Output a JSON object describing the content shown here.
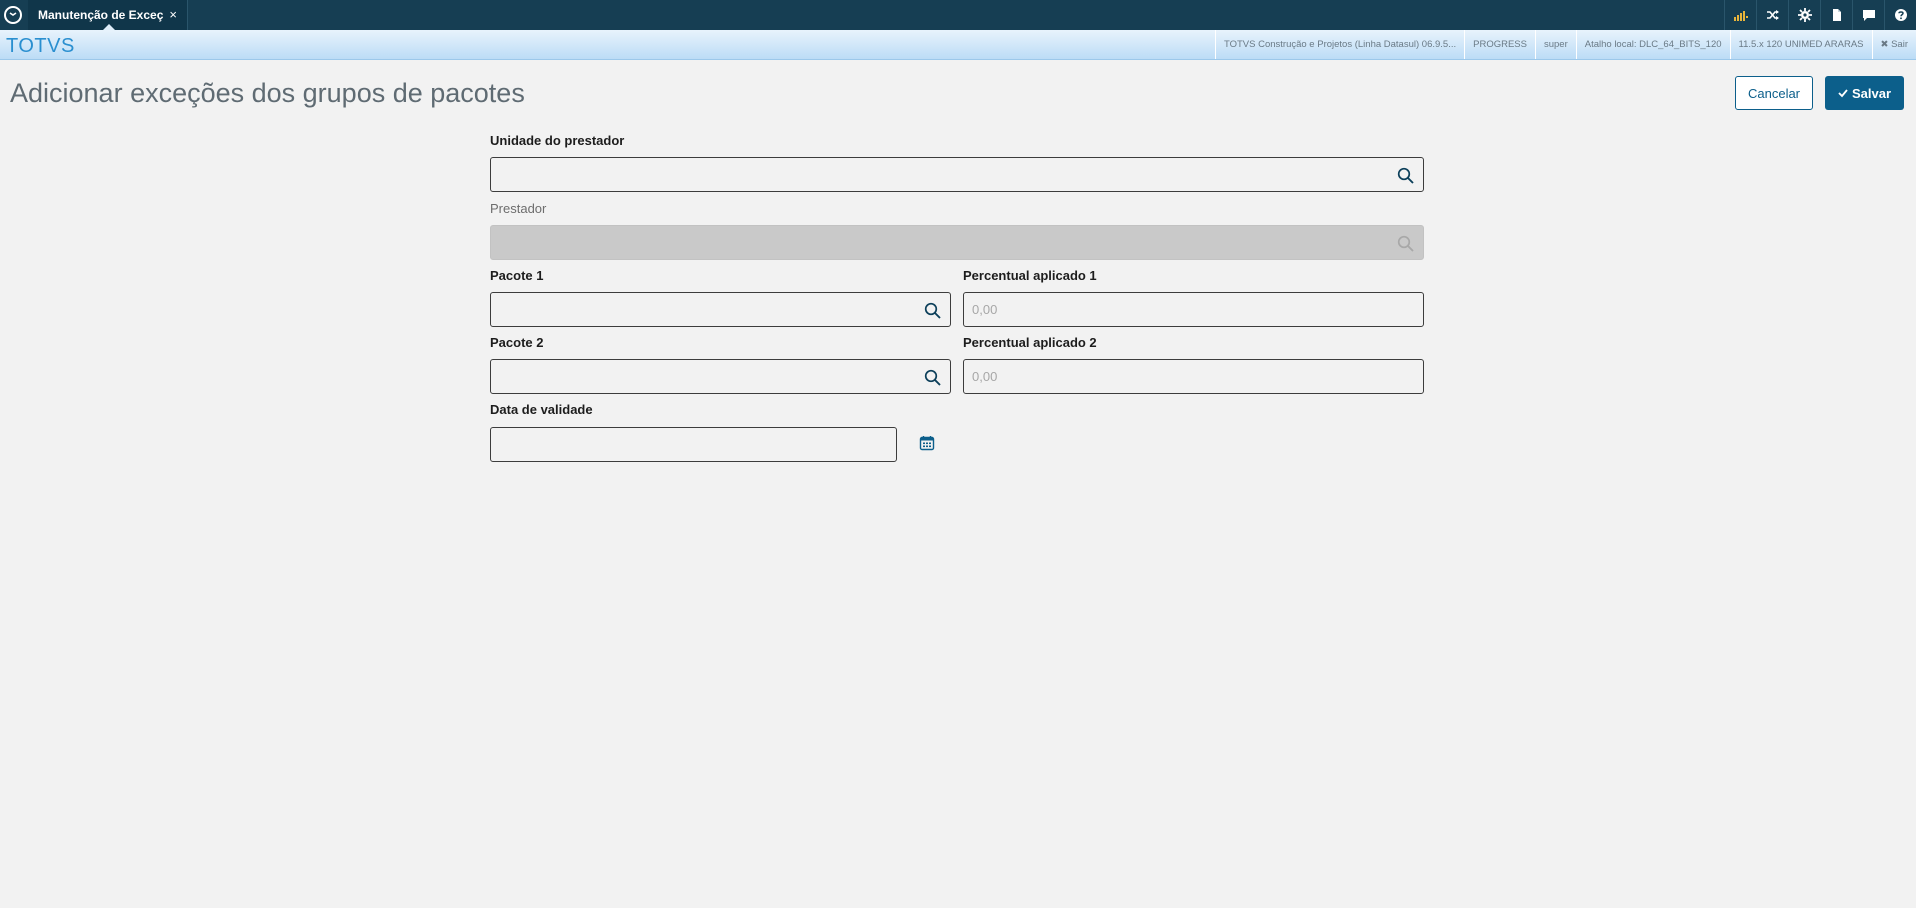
{
  "topbar": {
    "tab_label": "Manutenção de Exceç",
    "tab_close": "×",
    "icons": [
      "signal-icon",
      "shuffle-icon",
      "gear-icon",
      "document-icon",
      "chat-icon",
      "help-icon"
    ]
  },
  "brandbar": {
    "brand": "TOTVS",
    "info": [
      "TOTVS Construção e Projetos (Linha Datasul) 06.9.5...",
      "PROGRESS",
      "super",
      "Atalho local: DLC_64_BITS_120",
      "11.5.x 120 UNIMED ARARAS"
    ],
    "logout": "✖ Sair"
  },
  "page": {
    "title": "Adicionar exceções dos grupos de pacotes",
    "cancel_label": "Cancelar",
    "save_label": "Salvar"
  },
  "form": {
    "unidade_label": "Unidade do prestador",
    "unidade_value": "",
    "prestador_label": "Prestador",
    "prestador_value": "",
    "pacote1_label": "Pacote 1",
    "pacote1_value": "",
    "percentual1_label": "Percentual aplicado 1",
    "percentual1_placeholder": "0,00",
    "pacote2_label": "Pacote 2",
    "pacote2_value": "",
    "percentual2_label": "Percentual aplicado 2",
    "percentual2_placeholder": "0,00",
    "data_label": "Data de validade",
    "data_value": ""
  },
  "colors": {
    "topbar": "#163e53",
    "brand": "#2a8fd0",
    "primary": "#0c5f8b",
    "background": "#f2f2f2"
  }
}
